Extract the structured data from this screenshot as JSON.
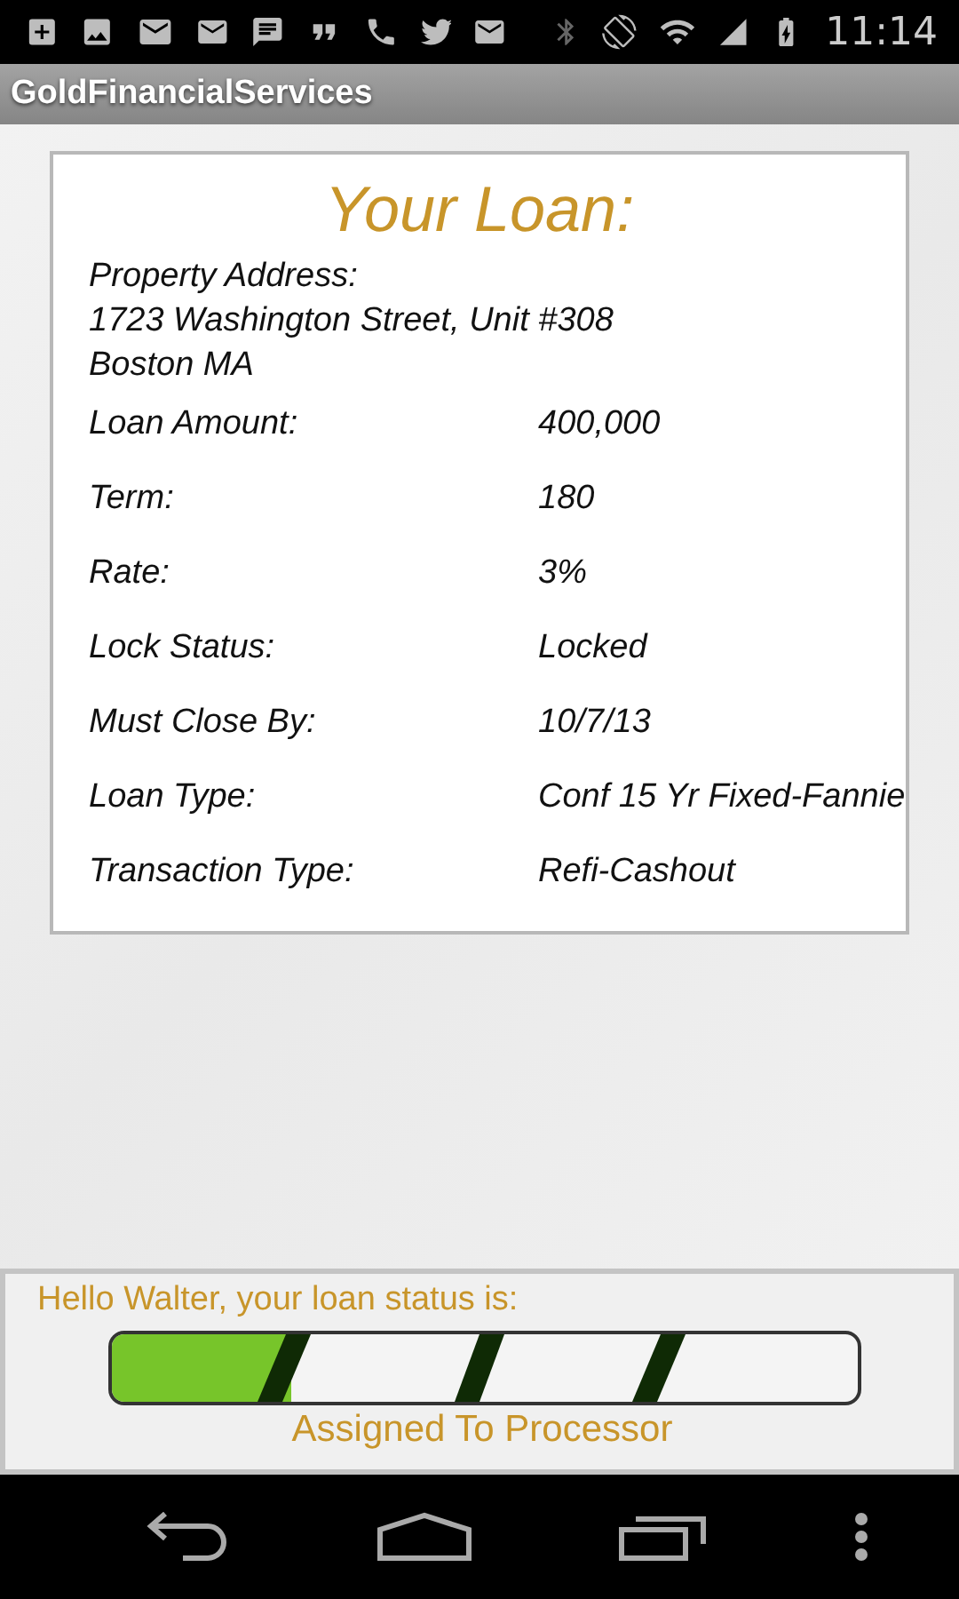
{
  "status_bar": {
    "time": "11:14"
  },
  "app_bar": {
    "title": "GoldFinancialServices"
  },
  "loan": {
    "title": "Your Loan:",
    "address_label": "Property Address:",
    "address_lines": [
      "1723 Washington Street, Unit #308",
      "Boston MA"
    ],
    "rows": [
      {
        "label": "Loan Amount:",
        "value": "400,000"
      },
      {
        "label": "Term:",
        "value": "180"
      },
      {
        "label": "Rate:",
        "value": "3%"
      },
      {
        "label": "Lock Status:",
        "value": "Locked"
      },
      {
        "label": "Must Close By:",
        "value": "10/7/13"
      },
      {
        "label": "Loan Type:",
        "value": "Conf 15 Yr Fixed-Fannie"
      },
      {
        "label": "Transaction Type:",
        "value": "Refi-Cashout"
      }
    ]
  },
  "status_panel": {
    "greeting": "Hello Walter, your loan status is:",
    "level": 0.24,
    "status": "Assigned To Processor"
  }
}
